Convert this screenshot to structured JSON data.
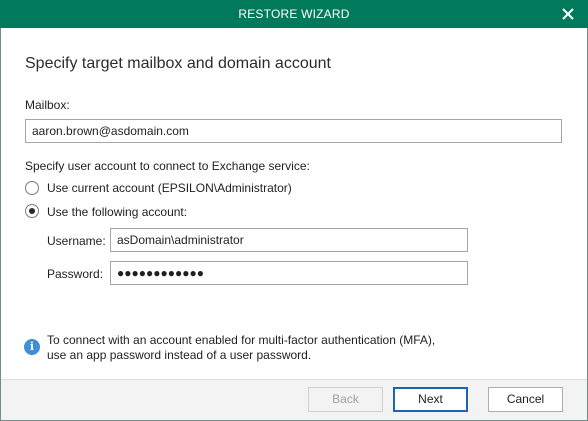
{
  "window": {
    "title": "RESTORE WIZARD",
    "close_icon": "close-icon",
    "accent_color": "#007a5a"
  },
  "page": {
    "heading": "Specify target mailbox and domain account"
  },
  "mailbox": {
    "label": "Mailbox:",
    "value": "aaron.brown@asdomain.com"
  },
  "account": {
    "section_label": "Specify user account to connect to Exchange service:",
    "options": [
      {
        "label": "Use current account (EPSILON\\Administrator)",
        "checked": false
      },
      {
        "label": "Use the following account:",
        "checked": true
      }
    ],
    "username_label": "Username:",
    "username_value": "asDomain\\administrator",
    "password_label": "Password:",
    "password_value": "●●●●●●●●●●●●"
  },
  "info": {
    "icon": "info-icon",
    "line1": "To connect with an account enabled for multi-factor authentication (MFA),",
    "line2": "use an app password instead of a user password."
  },
  "footer": {
    "back_label": "Back",
    "next_label": "Next",
    "cancel_label": "Cancel"
  }
}
